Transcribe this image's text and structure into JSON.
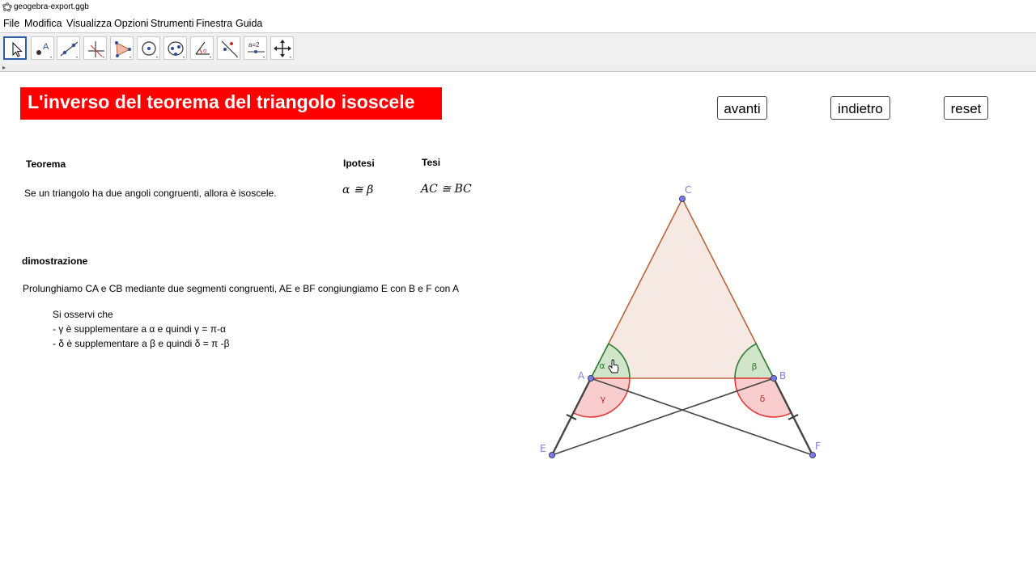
{
  "window": {
    "title": "geogebra-export.ggb"
  },
  "menu": [
    "File",
    "Modifica",
    "Visualizza",
    "Opzioni",
    "Strumenti",
    "Finestra",
    "Guida"
  ],
  "toolbar": {
    "tools": [
      "move-tool-icon",
      "point-tool-icon",
      "line-tool-icon",
      "perpendicular-tool-icon",
      "polygon-tool-icon",
      "circle-tool-icon",
      "conic-tool-icon",
      "angle-tool-icon",
      "reflect-tool-icon",
      "slider-tool-icon",
      "move-view-tool-icon"
    ],
    "slider_label": "a=2"
  },
  "page": {
    "title": "L'inverso del teorema del triangolo isoscele",
    "buttons": {
      "next": "avanti",
      "back": "indietro",
      "reset": "reset"
    },
    "theorem_heading": "Teorema",
    "hypothesis_heading": "Ipotesi",
    "thesis_heading": "Tesi",
    "theorem_text": "Se un triangolo ha due angoli congruenti, allora è isoscele.",
    "hypothesis_math": "α ≅ β",
    "thesis_math": "AC ≅ BC",
    "proof_heading": "dimostrazione",
    "proof_text": "Prolunghiamo CA e CB mediante due segmenti congruenti, AE e BF congiungiamo E con B e F con A",
    "notes": [
      "Si osservi che",
      "- γ è supplementare a α e quindi γ = π-α",
      "- δ è supplementare a β e quindi δ = π -β"
    ]
  },
  "figure": {
    "points": {
      "A": "A",
      "B": "B",
      "C": "C",
      "E": "E",
      "F": "F"
    },
    "angles": {
      "alpha": "α",
      "beta": "β",
      "gamma": "γ",
      "delta": "δ"
    },
    "colors": {
      "triangle_fill": "#f5e6df",
      "triangle_edge": "#b5673a",
      "green_sector": "#2e7d32",
      "red_sector": "#e53935",
      "point": "#7777ee",
      "label": "#8080dd"
    }
  }
}
